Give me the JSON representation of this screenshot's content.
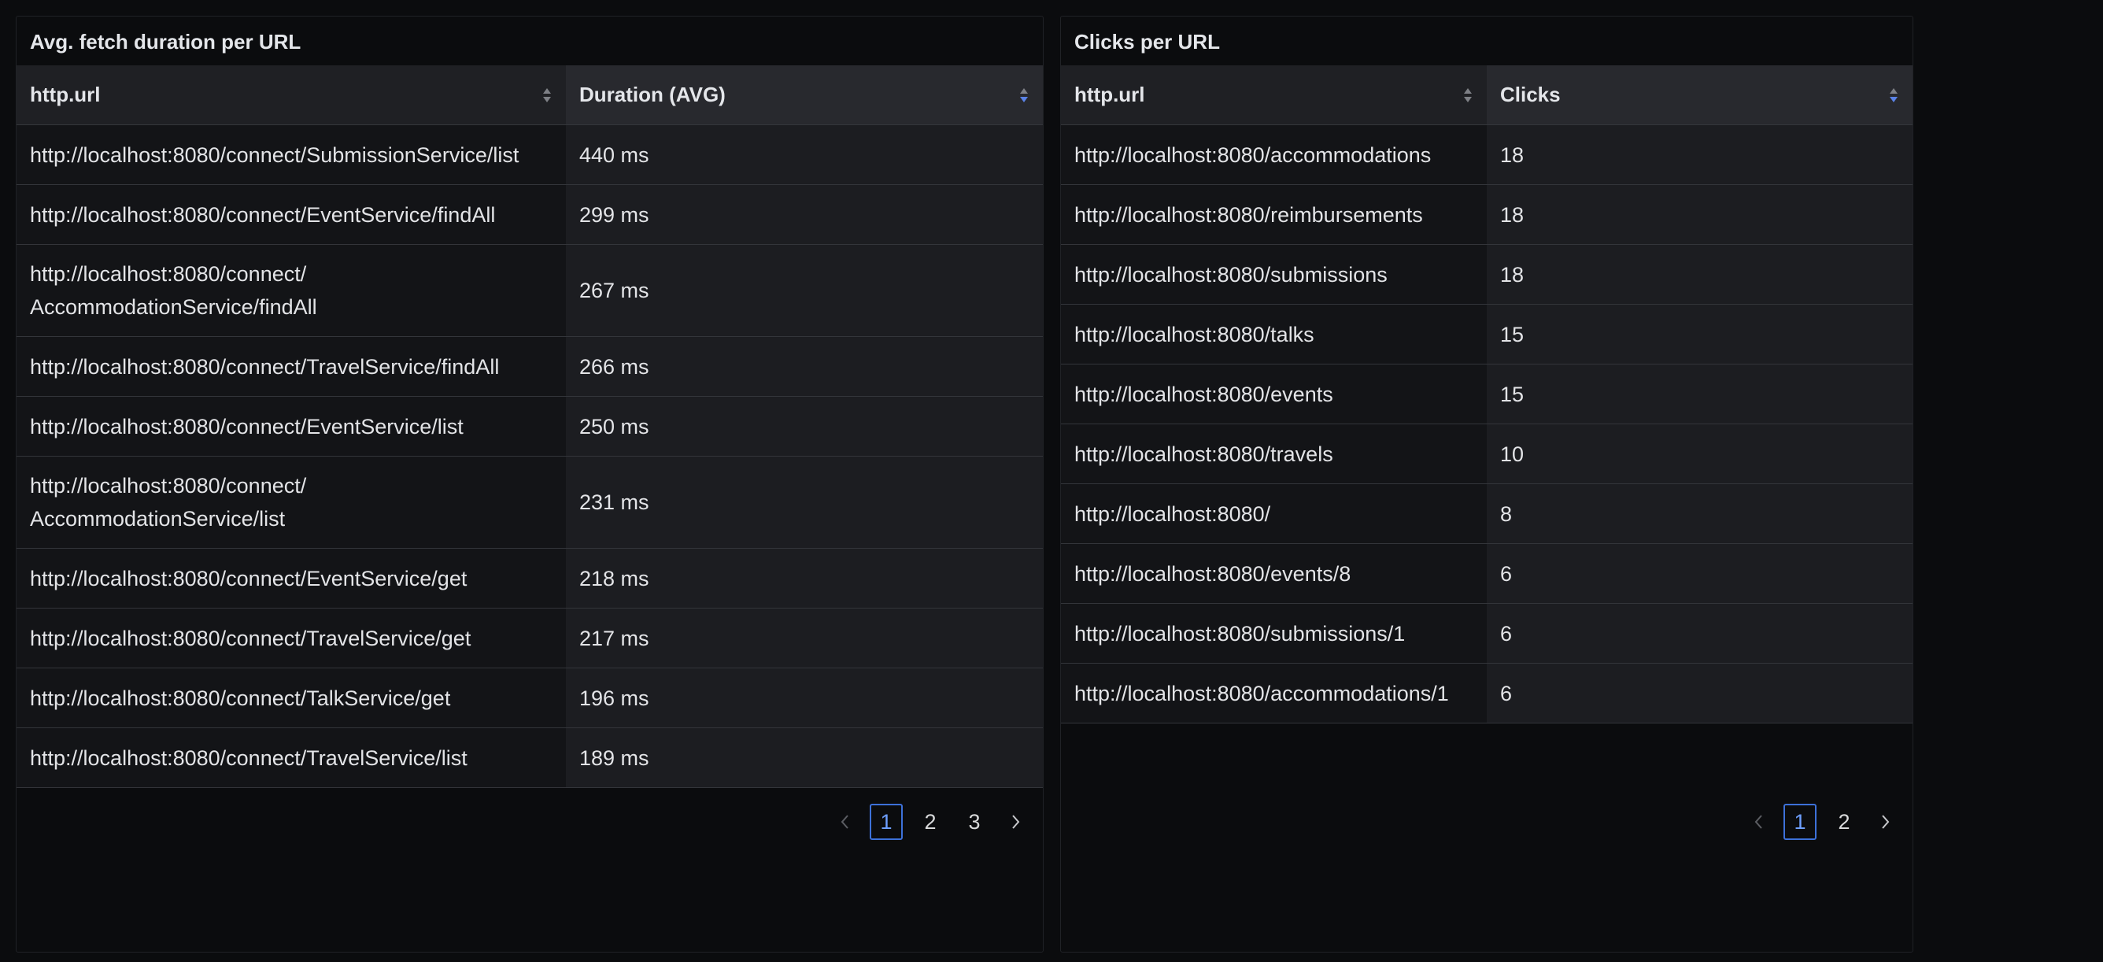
{
  "left_panel": {
    "title": "Avg. fetch duration per URL",
    "columns": [
      "http.url",
      "Duration (AVG)"
    ],
    "rows": [
      {
        "url": "http://localhost:8080/connect/SubmissionService/list",
        "value": "440 ms"
      },
      {
        "url": "http://localhost:8080/connect/EventService/findAll",
        "value": "299 ms"
      },
      {
        "url": "http://localhost:8080/connect/\nAccommodationService/findAll",
        "value": "267 ms"
      },
      {
        "url": "http://localhost:8080/connect/TravelService/findAll",
        "value": "266 ms"
      },
      {
        "url": "http://localhost:8080/connect/EventService/list",
        "value": "250 ms"
      },
      {
        "url": "http://localhost:8080/connect/\nAccommodationService/list",
        "value": "231 ms"
      },
      {
        "url": "http://localhost:8080/connect/EventService/get",
        "value": "218 ms"
      },
      {
        "url": "http://localhost:8080/connect/TravelService/get",
        "value": "217 ms"
      },
      {
        "url": "http://localhost:8080/connect/TalkService/get",
        "value": "196 ms"
      },
      {
        "url": "http://localhost:8080/connect/TravelService/list",
        "value": "189 ms"
      }
    ],
    "pagination": {
      "pages": [
        "1",
        "2",
        "3"
      ],
      "current": "1"
    }
  },
  "right_panel": {
    "title": "Clicks per URL",
    "columns": [
      "http.url",
      "Clicks"
    ],
    "rows": [
      {
        "url": "http://localhost:8080/accommodations",
        "value": "18"
      },
      {
        "url": "http://localhost:8080/reimbursements",
        "value": "18"
      },
      {
        "url": "http://localhost:8080/submissions",
        "value": "18"
      },
      {
        "url": "http://localhost:8080/talks",
        "value": "15"
      },
      {
        "url": "http://localhost:8080/events",
        "value": "15"
      },
      {
        "url": "http://localhost:8080/travels",
        "value": "10"
      },
      {
        "url": "http://localhost:8080/",
        "value": "8"
      },
      {
        "url": "http://localhost:8080/events/8",
        "value": "6"
      },
      {
        "url": "http://localhost:8080/submissions/1",
        "value": "6"
      },
      {
        "url": "http://localhost:8080/accommodations/1",
        "value": "6"
      }
    ],
    "pagination": {
      "pages": [
        "1",
        "2"
      ],
      "current": "1"
    }
  },
  "colors": {
    "accent": "#3d71d9",
    "sort_active": "#5a82e6",
    "sort_inactive": "#7e8086"
  }
}
